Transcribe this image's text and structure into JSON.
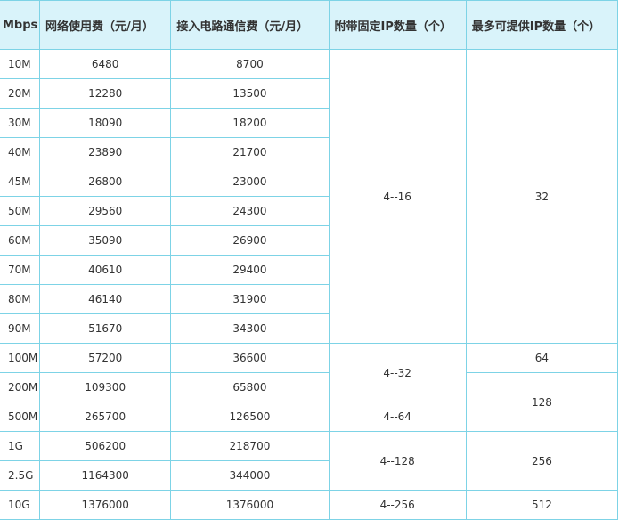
{
  "table": {
    "headers": [
      "Mbps",
      "网络使用费（元/月）",
      "接入电路通信费（元/月）",
      "附带固定IP数量（个）",
      "最多可提供IP数量（个）"
    ],
    "rows": [
      {
        "speed": "10M",
        "network_fee": "6480",
        "circuit_fee": "8700"
      },
      {
        "speed": "20M",
        "network_fee": "12280",
        "circuit_fee": "13500"
      },
      {
        "speed": "30M",
        "network_fee": "18090",
        "circuit_fee": "18200"
      },
      {
        "speed": "40M",
        "network_fee": "23890",
        "circuit_fee": "21700"
      },
      {
        "speed": "45M",
        "network_fee": "26800",
        "circuit_fee": "23000"
      },
      {
        "speed": "50M",
        "network_fee": "29560",
        "circuit_fee": "24300"
      },
      {
        "speed": "60M",
        "network_fee": "35090",
        "circuit_fee": "26900"
      },
      {
        "speed": "70M",
        "network_fee": "40610",
        "circuit_fee": "29400"
      },
      {
        "speed": "80M",
        "network_fee": "46140",
        "circuit_fee": "31900"
      },
      {
        "speed": "90M",
        "network_fee": "51670",
        "circuit_fee": "34300"
      },
      {
        "speed": "100M",
        "network_fee": "57200",
        "circuit_fee": "36600"
      },
      {
        "speed": "200M",
        "network_fee": "109300",
        "circuit_fee": "65800"
      },
      {
        "speed": "500M",
        "network_fee": "265700",
        "circuit_fee": "126500"
      },
      {
        "speed": "1G",
        "network_fee": "506200",
        "circuit_fee": "218700"
      },
      {
        "speed": "2.5G",
        "network_fee": "1164300",
        "circuit_fee": "344000"
      },
      {
        "speed": "10G",
        "network_fee": "1376000",
        "circuit_fee": "1376000"
      }
    ],
    "fixed_ip_groups": [
      "4--16",
      "4--32",
      "4--64",
      "4--128",
      "4--256"
    ],
    "max_ip_groups": [
      "32",
      "64",
      "128",
      "256",
      "512"
    ]
  },
  "colors": {
    "header_bg": "#d9f3fa",
    "border": "#7dd3e6",
    "text": "#333333"
  }
}
